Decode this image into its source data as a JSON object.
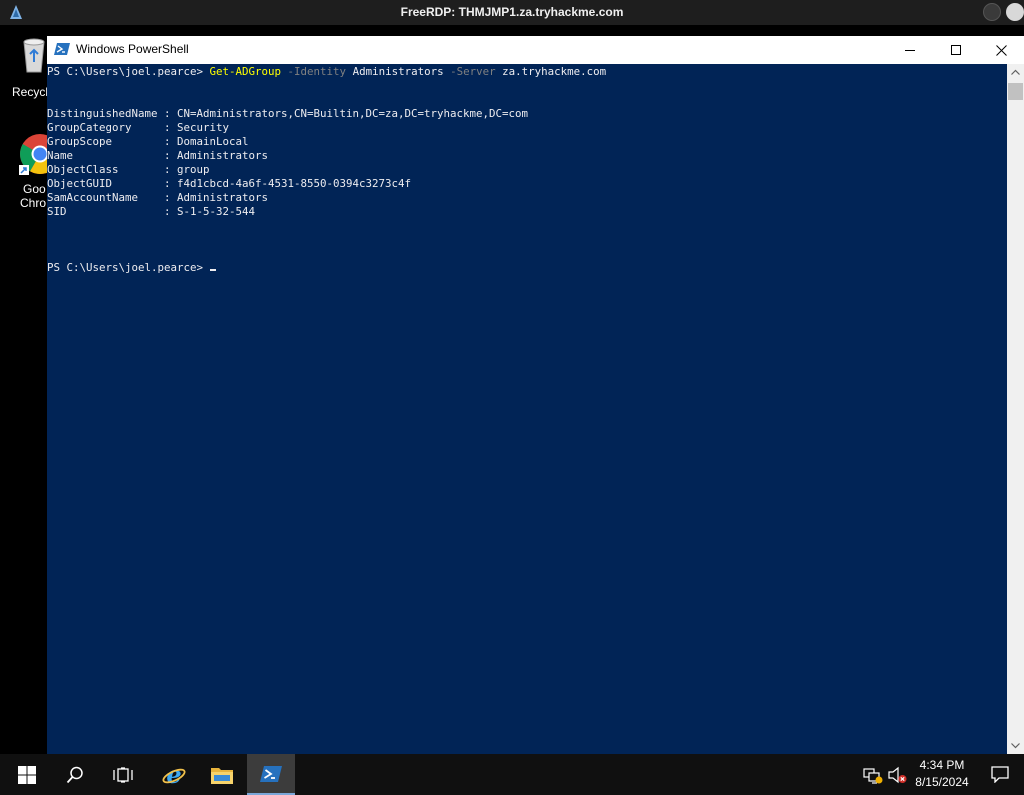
{
  "rdp": {
    "title": "FreeRDP: THMJMP1.za.tryhackme.com"
  },
  "desktop": {
    "icons": [
      {
        "label": "Recycl",
        "icon": "recycle-bin-icon"
      },
      {
        "label_line1": "Goo",
        "label_line2": "Chro",
        "icon": "google-chrome-icon"
      }
    ]
  },
  "window": {
    "title": "Windows PowerShell",
    "icon": "powershell-icon"
  },
  "console": {
    "prompt": "PS C:\\Users\\joel.pearce> ",
    "command": {
      "cmdlet": "Get-ADGroup",
      "param1": "-Identity",
      "value1": "Administrators",
      "param2": "-Server",
      "value2": "za.tryhackme.com"
    },
    "output": [
      {
        "key": "DistinguishedName",
        "value": "CN=Administrators,CN=Builtin,DC=za,DC=tryhackme,DC=com"
      },
      {
        "key": "GroupCategory",
        "value": "Security"
      },
      {
        "key": "GroupScope",
        "value": "DomainLocal"
      },
      {
        "key": "Name",
        "value": "Administrators"
      },
      {
        "key": "ObjectClass",
        "value": "group"
      },
      {
        "key": "ObjectGUID",
        "value": "f4d1cbcd-4a6f-4531-8550-0394c3273c4f"
      },
      {
        "key": "SamAccountName",
        "value": "Administrators"
      },
      {
        "key": "SID",
        "value": "S-1-5-32-544"
      }
    ],
    "final_prompt": "PS C:\\Users\\joel.pearce> "
  },
  "taskbar": {
    "items": [
      "start-icon",
      "search-icon",
      "task-view-icon",
      "internet-explorer-icon",
      "file-explorer-icon",
      "powershell-icon"
    ],
    "clock": {
      "time": "4:34 PM",
      "date": "8/15/2024"
    }
  },
  "colors": {
    "console_bg": "#012456",
    "console_fg": "#eeedf0",
    "cmdlet": "#ffff00",
    "parameter": "#808080"
  }
}
